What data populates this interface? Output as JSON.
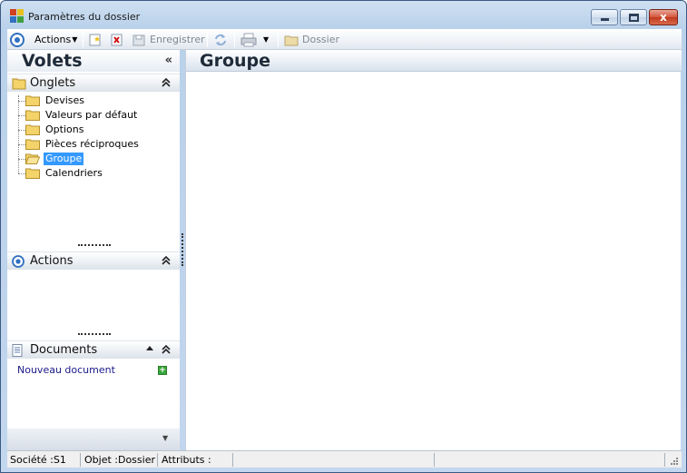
{
  "window": {
    "title": "Paramètres du dossier",
    "controls": {
      "minimize": "minimize",
      "maximize": "maximize",
      "close": "x"
    }
  },
  "toolbar": {
    "actions_label": "Actions",
    "save_label": "Enregistrer",
    "dossier_label": "Dossier"
  },
  "left_panel": {
    "title": "Volets",
    "collapse_symbol": "«",
    "onglets": {
      "label": "Onglets",
      "items": [
        {
          "label": "Devises",
          "selected": false
        },
        {
          "label": "Valeurs par défaut",
          "selected": false
        },
        {
          "label": "Options",
          "selected": false
        },
        {
          "label": "Pièces réciproques",
          "selected": false
        },
        {
          "label": "Groupe",
          "selected": true
        },
        {
          "label": "Calendriers",
          "selected": false
        }
      ]
    },
    "actions": {
      "label": "Actions"
    },
    "documents": {
      "label": "Documents",
      "new_document_link": "Nouveau document"
    }
  },
  "main": {
    "title": "Groupe"
  },
  "statusbar": {
    "societe": "Société :S1",
    "objet": "Objet :Dossier",
    "attributs": "Attributs :"
  },
  "colors": {
    "selection": "#3399ff",
    "link": "#1a1a8a",
    "close_button": "#c03a1f"
  }
}
